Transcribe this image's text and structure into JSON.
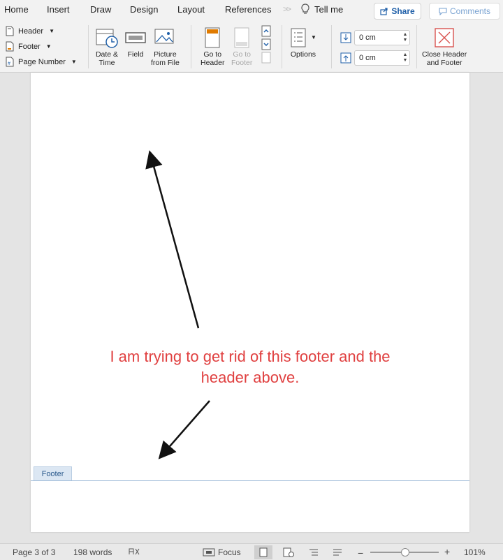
{
  "tabs": [
    "Home",
    "Insert",
    "Draw",
    "Design",
    "Layout",
    "References"
  ],
  "tab_more": ">>",
  "tell_me": "Tell me",
  "share_label": "Share",
  "comments_label": "Comments",
  "ribbon": {
    "header_label": "Header",
    "footer_label": "Footer",
    "page_number_label": "Page Number",
    "date_time_label": "Date &\nTime",
    "field_label": "Field",
    "picture_label": "Picture\nfrom File",
    "go_header_label": "Go to\nHeader",
    "go_footer_label": "Go to\nFooter",
    "options_label": "Options",
    "header_pos_value": "0 cm",
    "footer_pos_value": "0 cm",
    "close_label": "Close Header\nand Footer"
  },
  "document": {
    "annotation": "I am trying to get rid of this footer and the header above.",
    "footer_tab": "Footer"
  },
  "status": {
    "page": "Page 3 of 3",
    "words": "198 words",
    "focus": "Focus",
    "zoom": "101%",
    "zoom_minus": "−",
    "zoom_plus": "+"
  },
  "colors": {
    "annotation": "#e04040",
    "accent_blue": "#1f5fa8",
    "close_red": "#d9534f"
  }
}
